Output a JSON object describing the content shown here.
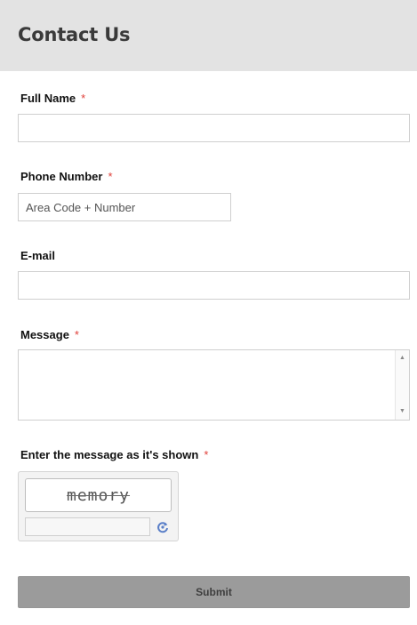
{
  "header": {
    "title": "Contact Us"
  },
  "required_marker": "*",
  "fields": {
    "full_name": {
      "label": "Full Name",
      "value": "",
      "placeholder": ""
    },
    "phone": {
      "label": "Phone Number",
      "value": "",
      "placeholder": "Area Code + Number"
    },
    "email": {
      "label": "E-mail",
      "value": "",
      "placeholder": ""
    },
    "message": {
      "label": "Message",
      "value": "",
      "placeholder": ""
    },
    "captcha": {
      "label": "Enter the message as it's shown",
      "image_text": "memory",
      "value": ""
    }
  },
  "submit_label": "Submit",
  "colors": {
    "header_bg": "#e3e3e3",
    "required": "#e0403a",
    "submit_bg": "#9b9b9b",
    "refresh_icon": "#5a7fc8"
  }
}
